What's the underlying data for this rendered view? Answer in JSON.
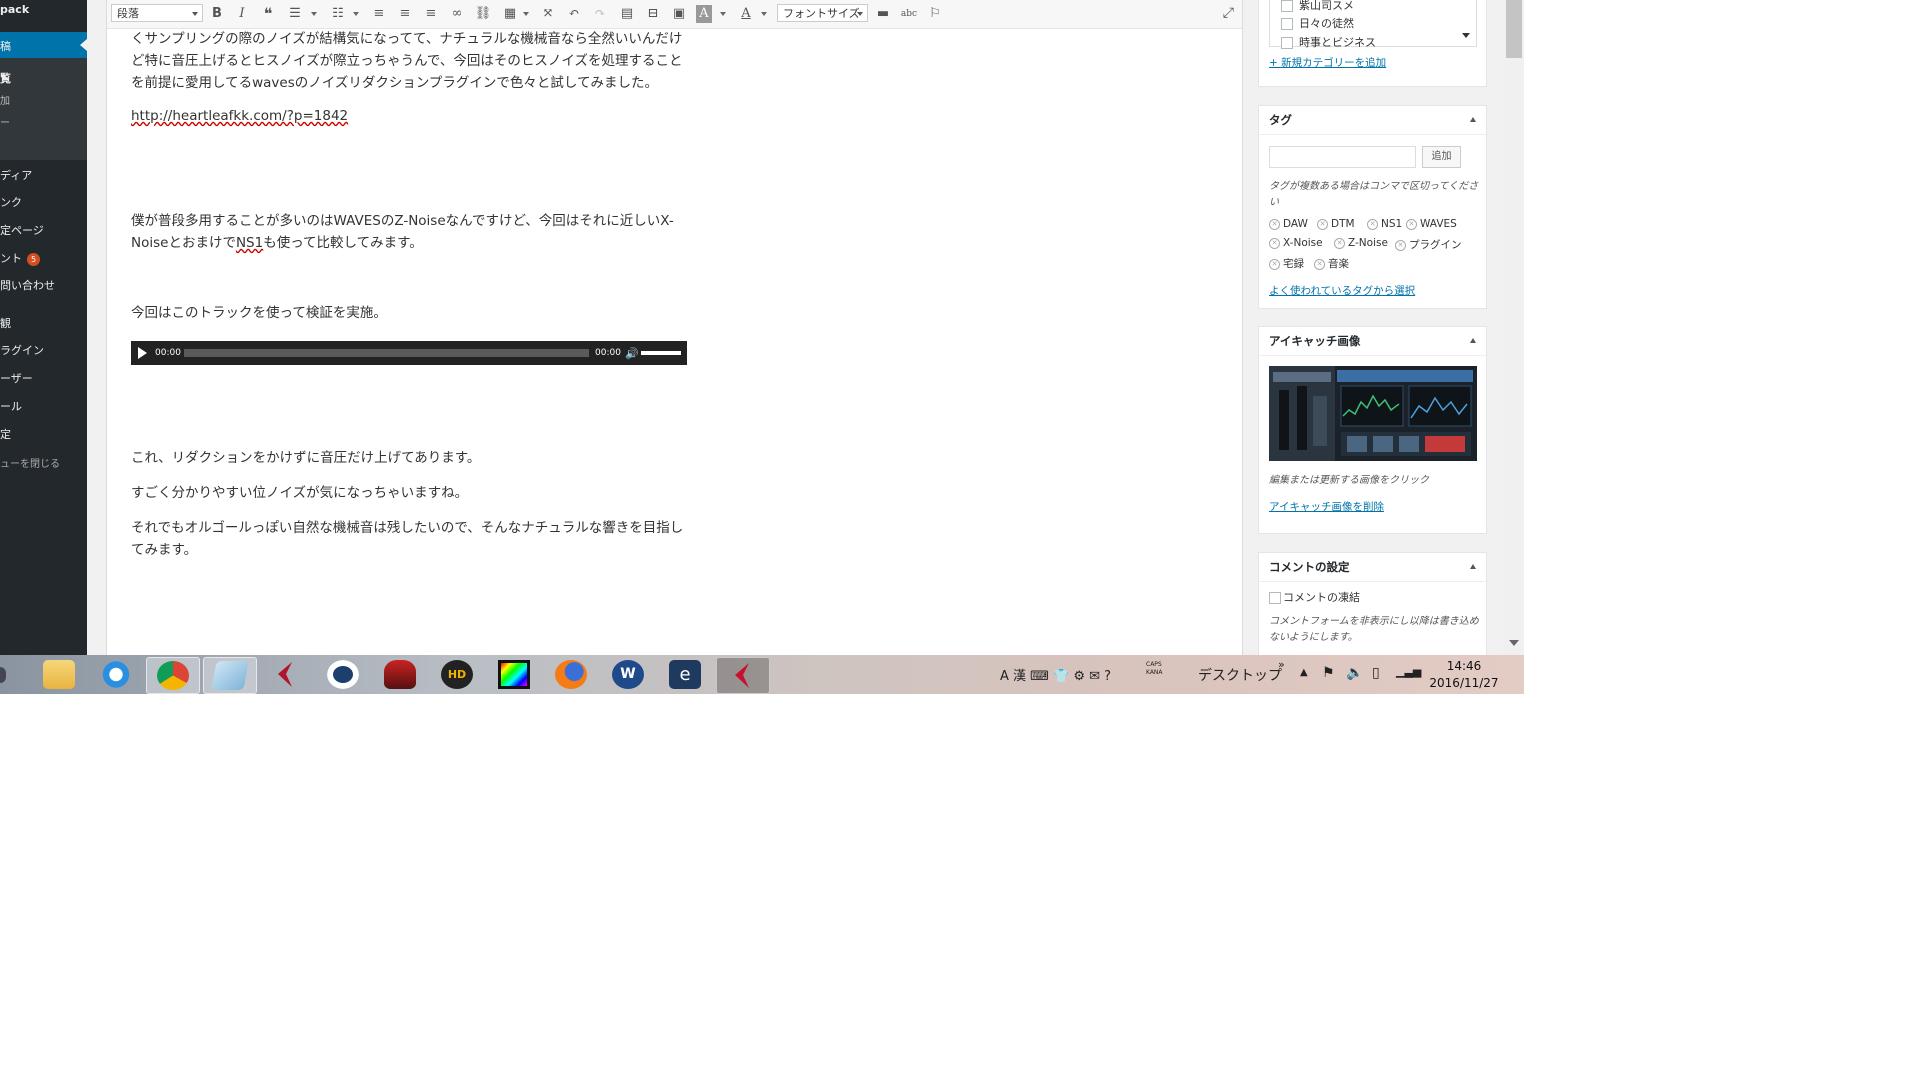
{
  "sidebar": {
    "items": [
      {
        "label": "pack"
      },
      {
        "label": "稿"
      },
      {
        "label": "覧"
      },
      {
        "label": "加"
      },
      {
        "label": "ー"
      },
      {
        "label": "ディア"
      },
      {
        "label": "ンク"
      },
      {
        "label": "定ページ"
      },
      {
        "label": "ント",
        "badge": "5"
      },
      {
        "label": "問い合わせ"
      },
      {
        "label": "観"
      },
      {
        "label": "ラグイン"
      },
      {
        "label": "ーザー"
      },
      {
        "label": "ール"
      },
      {
        "label": "定"
      },
      {
        "label": "ューを閉じる"
      }
    ]
  },
  "toolbar": {
    "format_select": "段落",
    "font_size_select": "フォントサイズ"
  },
  "content": {
    "p1": "くサンプリングの際のノイズが結構気になってて、ナチュラルな機械音なら全然いいんだけど特に音圧上げるとヒスノイズが際立っちゃうんで、今回はそのヒスノイズを処理することを前提に愛用してるwavesのノイズリダクションプラグインで色々と試してみました。",
    "link": "http://heartleafkk.com/?p=1842",
    "p2a": "僕が普段多用することが多いのはWAVESのZ-Noiseなんですけど、今回はそれに近しいX-Noiseとおまけで",
    "p2b": "NS1",
    "p2c": "も使って比較してみます。",
    "p3": "今回はこのトラックを使って検証を実施。",
    "p4": "これ、リダクションをかけずに音圧だけ上げてあります。",
    "p5": "すごく分かりやすい位ノイズが気になっちゃいますね。",
    "p6": "それでもオルゴールっぽい自然な機械音は残したいので、そんなナチュラルな響きを目指してみます。"
  },
  "player": {
    "current_time": "00:00",
    "duration": "00:00",
    "progress": 0
  },
  "categories": {
    "items": [
      "紫山司スメ",
      "日々の徒然",
      "時事とビジネス"
    ],
    "add_link": "+ 新規カテゴリーを追加"
  },
  "tags": {
    "title": "タグ",
    "add_button": "追加",
    "hint": "タグが複数ある場合はコンマで区切ってください",
    "items": [
      "DAW",
      "DTM",
      "NS1",
      "WAVES",
      "X-Noise",
      "Z-Noise",
      "プラグイン",
      "宅録",
      "音楽"
    ],
    "popular_link": "よく使われているタグから選択"
  },
  "featured_image": {
    "title": "アイキャッチ画像",
    "hint": "編集または更新する画像をクリック",
    "remove_link": "アイキャッチ画像を削除"
  },
  "comments": {
    "title": "コメントの設定",
    "checkbox_label": "コメントの凍結",
    "hint": "コメントフォームを非表示にし以降は書き込めないようにします。"
  },
  "taskbar": {
    "desktop_label": "デスクトップ",
    "time": "14:46",
    "date": "2016/11/27",
    "caps": "CAPS",
    "kana": "KANA"
  },
  "colors": {
    "sidebar_bg": "#23282d",
    "active_menu": "#0073aa",
    "link": "#0073aa",
    "badge": "#d54e21"
  }
}
